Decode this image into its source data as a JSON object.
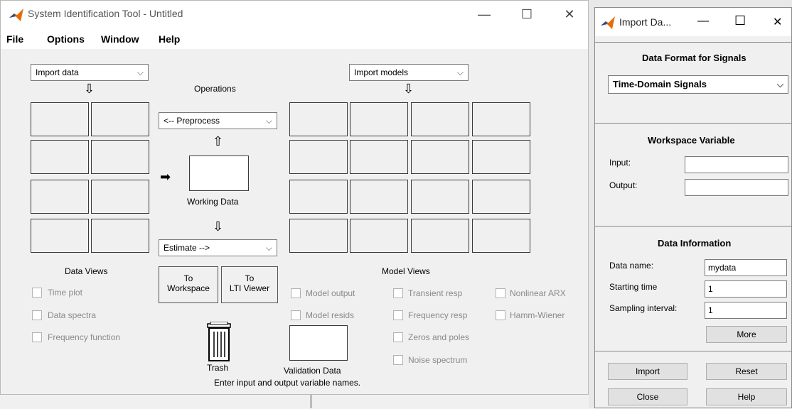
{
  "main": {
    "title": "System Identification Tool - Untitled",
    "window_controls": {
      "minimize": "—",
      "maximize": "☐",
      "close": "✕"
    },
    "menu": [
      "File",
      "Options",
      "Window",
      "Help"
    ],
    "import_data": "Import data",
    "import_models": "Import models",
    "operations": "Operations",
    "preprocess": "<-- Preprocess",
    "working_data": "Working Data",
    "estimate": "Estimate -->",
    "data_views": "Data Views",
    "model_views": "Model Views",
    "to_workspace": [
      "To",
      "Workspace"
    ],
    "to_lti": [
      "To",
      "LTI Viewer"
    ],
    "trash": "Trash",
    "validation_data": "Validation Data",
    "status": "Enter input and output variable names.",
    "data_view_checks": [
      "Time plot",
      "Data spectra",
      "Frequency function"
    ],
    "model_checks_col1": [
      "Model output",
      "Model resids"
    ],
    "model_checks_col2": [
      "Transient resp",
      "Frequency resp",
      "Zeros and poles",
      "Noise spectrum"
    ],
    "model_checks_col3": [
      "Nonlinear ARX",
      "Hamm-Wiener"
    ]
  },
  "import": {
    "title": "Import Da...",
    "window_controls": {
      "minimize": "—",
      "maximize": "☐",
      "close": "✕"
    },
    "format_heading": "Data Format for Signals",
    "format_value": "Time-Domain Signals",
    "workspace_heading": "Workspace Variable",
    "input_label": "Input:",
    "input_value": "",
    "output_label": "Output:",
    "output_value": "",
    "info_heading": "Data Information",
    "data_name_label": "Data name:",
    "data_name_value": "mydata",
    "start_label": "Starting time",
    "start_value": "1",
    "interval_label": "Sampling interval:",
    "interval_value": "1",
    "more": "More",
    "import_btn": "Import",
    "reset_btn": "Reset",
    "close_btn": "Close",
    "help_btn": "Help"
  },
  "colors": {
    "matlab_orange": "#e46c0a",
    "matlab_blue": "#1f4e9b"
  }
}
